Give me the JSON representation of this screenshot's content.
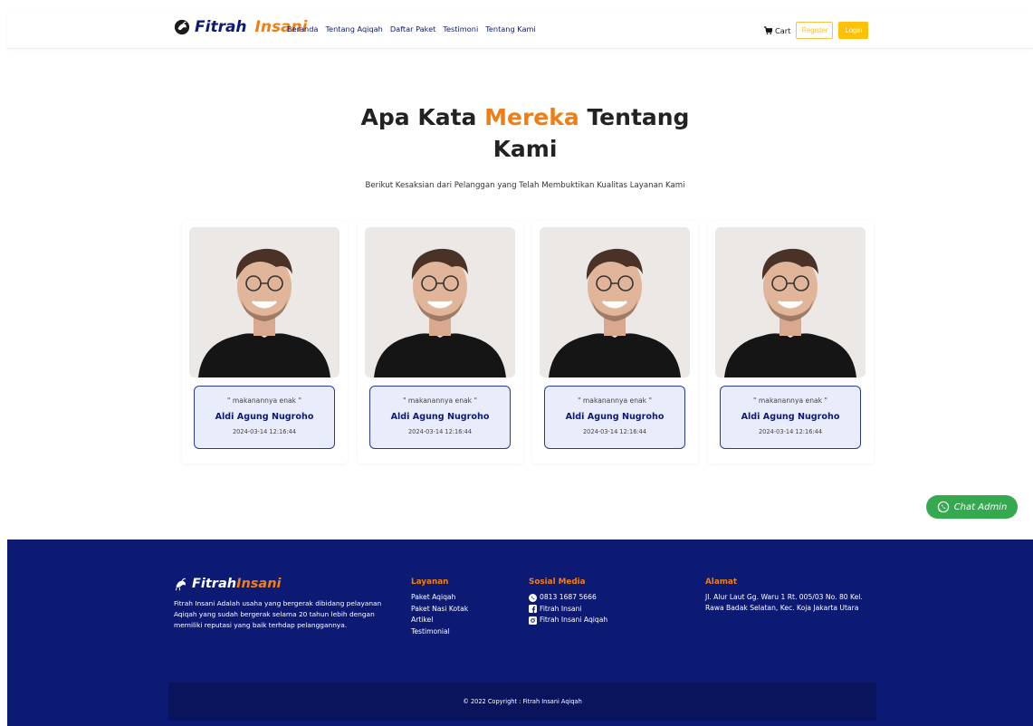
{
  "navbar": {
    "brand_part1": "Fitrah",
    "brand_part2": "Insani",
    "links": [
      "Beranda",
      "Tentang Aqiqah",
      "Daftar Paket",
      "Testimoni",
      "Tentang Kami"
    ],
    "cart_label": "Cart",
    "register_label": "Register",
    "login_label": "Login"
  },
  "hero": {
    "title_part1": "Apa Kata ",
    "title_accent": "Mereka",
    "title_part2": " Tentang Kami",
    "subtitle": "Berikut Kesaksian dari Pelanggan yang Telah Membuktikan Kualitas Layanan Kami"
  },
  "testimonials": [
    {
      "quote": "\" makanannya enak \"",
      "name": "Aldi Agung Nugroho",
      "date": "2024-03-14 12:16:44"
    },
    {
      "quote": "\" makanannya enak \"",
      "name": "Aldi Agung Nugroho",
      "date": "2024-03-14 12:16:44"
    },
    {
      "quote": "\" makanannya enak \"",
      "name": "Aldi Agung Nugroho",
      "date": "2024-03-14 12:16:44"
    },
    {
      "quote": "\" makanannya enak \"",
      "name": "Aldi Agung Nugroho",
      "date": "2024-03-14 12:16:44"
    }
  ],
  "chat": {
    "label": "Chat Admin"
  },
  "footer": {
    "brand_part1": "Fitrah",
    "brand_part2": "Insani",
    "description": "Fitrah Insani Adalah usaha yang bergerak dibidang pelayanan Aqiqah yang sudah bergerak selama 20 tahun lebih dengan memiliki reputasi yang baik terhdap pelanggannya.",
    "layanan_heading": "Layanan",
    "layanan_items": [
      "Paket Aqiqah",
      "Paket Nasi Kotak",
      "Artikel",
      "Testimonial"
    ],
    "sosial_heading": "Sosial Media",
    "sosial_items": [
      "0813 1687 5666",
      "Fitrah Insani",
      "Fitrah Insani Aqiqah"
    ],
    "alamat_heading": "Alamat",
    "alamat_text": "Jl. Alur Laut Gg. Waru 1 Rt. 005/03 No. 80 Kel. Rawa Badak Selatan, Kec. Koja Jakarta Utara",
    "copyright": "2022 Copyright : Fitrah Insani Aqiqah"
  },
  "colors": {
    "navy": "#0d1a73",
    "orange": "#f07e12",
    "yellow": "#ffc107",
    "green": "#35a94f",
    "card_bg": "#e9ecfb"
  }
}
